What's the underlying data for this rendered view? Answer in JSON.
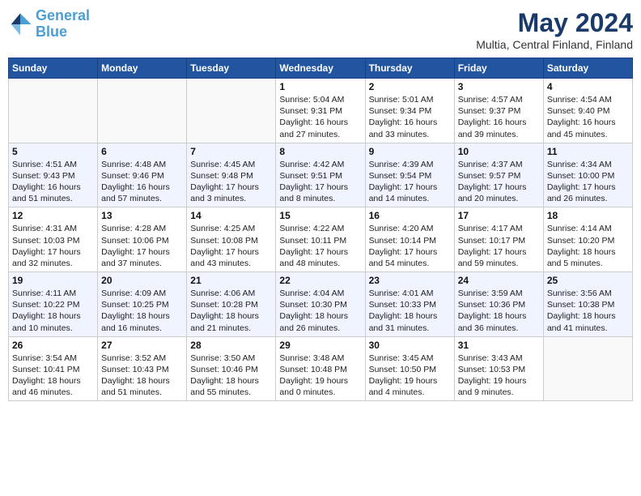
{
  "logo": {
    "line1": "General",
    "line2": "Blue"
  },
  "title": "May 2024",
  "location": "Multia, Central Finland, Finland",
  "weekdays": [
    "Sunday",
    "Monday",
    "Tuesday",
    "Wednesday",
    "Thursday",
    "Friday",
    "Saturday"
  ],
  "weeks": [
    [
      {
        "day": "",
        "info": ""
      },
      {
        "day": "",
        "info": ""
      },
      {
        "day": "",
        "info": ""
      },
      {
        "day": "1",
        "info": "Sunrise: 5:04 AM\nSunset: 9:31 PM\nDaylight: 16 hours\nand 27 minutes."
      },
      {
        "day": "2",
        "info": "Sunrise: 5:01 AM\nSunset: 9:34 PM\nDaylight: 16 hours\nand 33 minutes."
      },
      {
        "day": "3",
        "info": "Sunrise: 4:57 AM\nSunset: 9:37 PM\nDaylight: 16 hours\nand 39 minutes."
      },
      {
        "day": "4",
        "info": "Sunrise: 4:54 AM\nSunset: 9:40 PM\nDaylight: 16 hours\nand 45 minutes."
      }
    ],
    [
      {
        "day": "5",
        "info": "Sunrise: 4:51 AM\nSunset: 9:43 PM\nDaylight: 16 hours\nand 51 minutes."
      },
      {
        "day": "6",
        "info": "Sunrise: 4:48 AM\nSunset: 9:46 PM\nDaylight: 16 hours\nand 57 minutes."
      },
      {
        "day": "7",
        "info": "Sunrise: 4:45 AM\nSunset: 9:48 PM\nDaylight: 17 hours\nand 3 minutes."
      },
      {
        "day": "8",
        "info": "Sunrise: 4:42 AM\nSunset: 9:51 PM\nDaylight: 17 hours\nand 8 minutes."
      },
      {
        "day": "9",
        "info": "Sunrise: 4:39 AM\nSunset: 9:54 PM\nDaylight: 17 hours\nand 14 minutes."
      },
      {
        "day": "10",
        "info": "Sunrise: 4:37 AM\nSunset: 9:57 PM\nDaylight: 17 hours\nand 20 minutes."
      },
      {
        "day": "11",
        "info": "Sunrise: 4:34 AM\nSunset: 10:00 PM\nDaylight: 17 hours\nand 26 minutes."
      }
    ],
    [
      {
        "day": "12",
        "info": "Sunrise: 4:31 AM\nSunset: 10:03 PM\nDaylight: 17 hours\nand 32 minutes."
      },
      {
        "day": "13",
        "info": "Sunrise: 4:28 AM\nSunset: 10:06 PM\nDaylight: 17 hours\nand 37 minutes."
      },
      {
        "day": "14",
        "info": "Sunrise: 4:25 AM\nSunset: 10:08 PM\nDaylight: 17 hours\nand 43 minutes."
      },
      {
        "day": "15",
        "info": "Sunrise: 4:22 AM\nSunset: 10:11 PM\nDaylight: 17 hours\nand 48 minutes."
      },
      {
        "day": "16",
        "info": "Sunrise: 4:20 AM\nSunset: 10:14 PM\nDaylight: 17 hours\nand 54 minutes."
      },
      {
        "day": "17",
        "info": "Sunrise: 4:17 AM\nSunset: 10:17 PM\nDaylight: 17 hours\nand 59 minutes."
      },
      {
        "day": "18",
        "info": "Sunrise: 4:14 AM\nSunset: 10:20 PM\nDaylight: 18 hours\nand 5 minutes."
      }
    ],
    [
      {
        "day": "19",
        "info": "Sunrise: 4:11 AM\nSunset: 10:22 PM\nDaylight: 18 hours\nand 10 minutes."
      },
      {
        "day": "20",
        "info": "Sunrise: 4:09 AM\nSunset: 10:25 PM\nDaylight: 18 hours\nand 16 minutes."
      },
      {
        "day": "21",
        "info": "Sunrise: 4:06 AM\nSunset: 10:28 PM\nDaylight: 18 hours\nand 21 minutes."
      },
      {
        "day": "22",
        "info": "Sunrise: 4:04 AM\nSunset: 10:30 PM\nDaylight: 18 hours\nand 26 minutes."
      },
      {
        "day": "23",
        "info": "Sunrise: 4:01 AM\nSunset: 10:33 PM\nDaylight: 18 hours\nand 31 minutes."
      },
      {
        "day": "24",
        "info": "Sunrise: 3:59 AM\nSunset: 10:36 PM\nDaylight: 18 hours\nand 36 minutes."
      },
      {
        "day": "25",
        "info": "Sunrise: 3:56 AM\nSunset: 10:38 PM\nDaylight: 18 hours\nand 41 minutes."
      }
    ],
    [
      {
        "day": "26",
        "info": "Sunrise: 3:54 AM\nSunset: 10:41 PM\nDaylight: 18 hours\nand 46 minutes."
      },
      {
        "day": "27",
        "info": "Sunrise: 3:52 AM\nSunset: 10:43 PM\nDaylight: 18 hours\nand 51 minutes."
      },
      {
        "day": "28",
        "info": "Sunrise: 3:50 AM\nSunset: 10:46 PM\nDaylight: 18 hours\nand 55 minutes."
      },
      {
        "day": "29",
        "info": "Sunrise: 3:48 AM\nSunset: 10:48 PM\nDaylight: 19 hours\nand 0 minutes."
      },
      {
        "day": "30",
        "info": "Sunrise: 3:45 AM\nSunset: 10:50 PM\nDaylight: 19 hours\nand 4 minutes."
      },
      {
        "day": "31",
        "info": "Sunrise: 3:43 AM\nSunset: 10:53 PM\nDaylight: 19 hours\nand 9 minutes."
      },
      {
        "day": "",
        "info": ""
      }
    ]
  ]
}
